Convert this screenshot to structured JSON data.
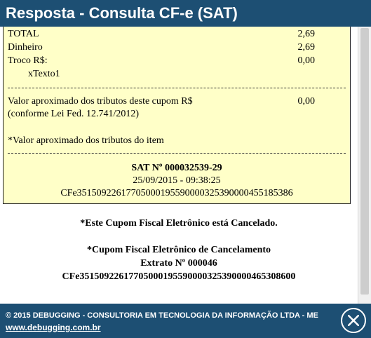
{
  "window": {
    "title": "Resposta - Consulta CF-e (SAT)"
  },
  "receipt": {
    "total_label": "TOTAL",
    "total_value": "2,69",
    "cash_label": "Dinheiro",
    "cash_value": "2,69",
    "change_label": "Troco R$:",
    "change_value": "0,00",
    "extra_text": "xTexto1",
    "tax_line1": "Valor aproximado dos tributos deste cupom R$",
    "tax_line2": "(conforme Lei Fed. 12.741/2012)",
    "tax_value": "0,00",
    "item_tax_note": "*Valor aproximado dos tributos do item",
    "sat_number": "SAT Nº 000032539-29",
    "datetime": "25/09/2015 - 09:38:25",
    "access_key": "CFe35150922617705000195590000325390000455185386"
  },
  "notes": {
    "cancelled": "*Este Cupom Fiscal Eletrônico está Cancelado.",
    "cancel_title": "*Cupom Fiscal Eletrônico de Cancelamento",
    "extract": "Extrato Nº 000046",
    "cancel_key": "CFe35150922617705000195590000325390000465308600"
  },
  "footer": {
    "copyright": "© 2015 DEBUGGING - CONSULTORIA EM TECNOLOGIA DA INFORMAÇÃO LTDA - ME",
    "website": "www.debugging.com.br"
  },
  "colors": {
    "title_bar": "#1d4f73",
    "receipt_background": "#ffffc8"
  },
  "icons": {
    "close": "close-icon"
  }
}
